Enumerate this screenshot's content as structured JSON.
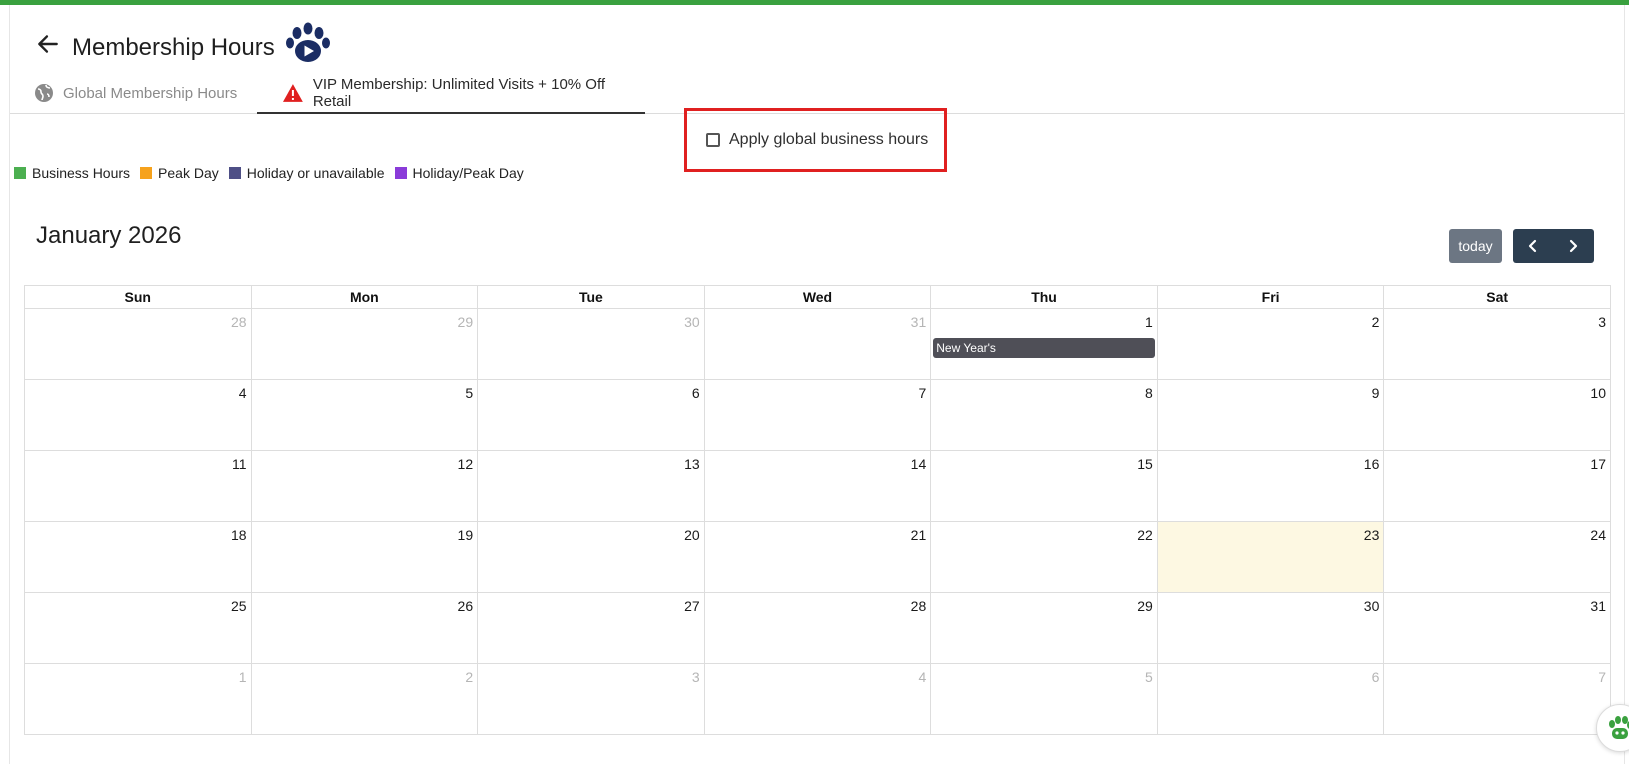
{
  "header": {
    "title": "Membership Hours",
    "back_icon": "arrow-left-icon",
    "logo_icon": "paw-play-icon",
    "logo_color": "#1b2d64"
  },
  "tabs": [
    {
      "label": "Global Membership Hours",
      "icon": "globe-icon",
      "active": false
    },
    {
      "label": "VIP Membership: Unlimited Visits + 10% Off Retail",
      "icon": "warning-triangle-icon",
      "active": true
    }
  ],
  "apply_global": {
    "label": "Apply global business hours",
    "checked": false,
    "highlight_color": "#e02020"
  },
  "legend": [
    {
      "label": "Business Hours",
      "color": "#4caf50"
    },
    {
      "label": "Peak Day",
      "color": "#f6a21c"
    },
    {
      "label": "Holiday or unavailable",
      "color": "#4e4f86"
    },
    {
      "label": "Holiday/Peak Day",
      "color": "#8a3bd9"
    }
  ],
  "calendar": {
    "title": "January 2026",
    "today_label": "today",
    "prev_icon": "chevron-left-icon",
    "next_icon": "chevron-right-icon",
    "day_headers": [
      "Sun",
      "Mon",
      "Tue",
      "Wed",
      "Thu",
      "Fri",
      "Sat"
    ],
    "weeks": [
      [
        {
          "n": "28",
          "other": true
        },
        {
          "n": "29",
          "other": true
        },
        {
          "n": "30",
          "other": true
        },
        {
          "n": "31",
          "other": true
        },
        {
          "n": "1",
          "event": "New Year's"
        },
        {
          "n": "2"
        },
        {
          "n": "3"
        }
      ],
      [
        {
          "n": "4"
        },
        {
          "n": "5"
        },
        {
          "n": "6"
        },
        {
          "n": "7"
        },
        {
          "n": "8"
        },
        {
          "n": "9"
        },
        {
          "n": "10"
        }
      ],
      [
        {
          "n": "11"
        },
        {
          "n": "12"
        },
        {
          "n": "13"
        },
        {
          "n": "14"
        },
        {
          "n": "15"
        },
        {
          "n": "16"
        },
        {
          "n": "17"
        }
      ],
      [
        {
          "n": "18"
        },
        {
          "n": "19"
        },
        {
          "n": "20"
        },
        {
          "n": "21"
        },
        {
          "n": "22"
        },
        {
          "n": "23",
          "today": true
        },
        {
          "n": "24"
        }
      ],
      [
        {
          "n": "25"
        },
        {
          "n": "26"
        },
        {
          "n": "27"
        },
        {
          "n": "28"
        },
        {
          "n": "29"
        },
        {
          "n": "30"
        },
        {
          "n": "31"
        }
      ],
      [
        {
          "n": "1",
          "other": true
        },
        {
          "n": "2",
          "other": true
        },
        {
          "n": "3",
          "other": true
        },
        {
          "n": "4",
          "other": true
        },
        {
          "n": "5",
          "other": true
        },
        {
          "n": "6",
          "other": true
        },
        {
          "n": "7",
          "other": true
        }
      ]
    ],
    "today_highlight": "#fdf8e2",
    "event_color": "#4f4f57"
  },
  "chat_widget_icon": "paw-chat-icon"
}
